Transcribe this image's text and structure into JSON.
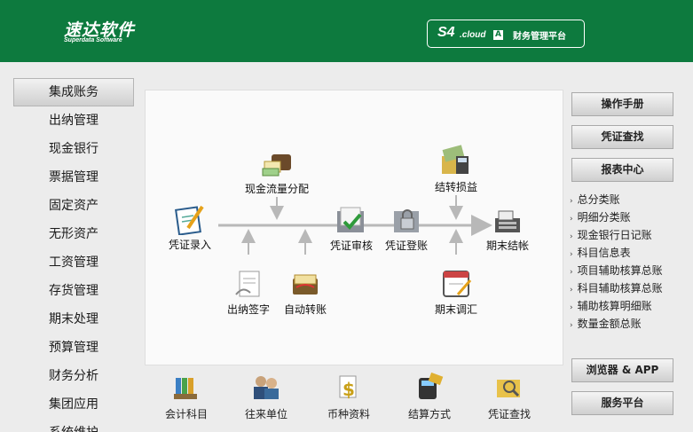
{
  "header": {
    "logo_main": "速达软件",
    "logo_sub": "Superdata Software",
    "product": "S4",
    "cloud": ".cloud",
    "cloud_badge": "A",
    "platform": "财务管理平台"
  },
  "sidebar": {
    "items": [
      {
        "label": "集成账务"
      },
      {
        "label": "出纳管理"
      },
      {
        "label": "现金银行"
      },
      {
        "label": "票据管理"
      },
      {
        "label": "固定资产"
      },
      {
        "label": "无形资产"
      },
      {
        "label": "工资管理"
      },
      {
        "label": "存货管理"
      },
      {
        "label": "期末处理"
      },
      {
        "label": "预算管理"
      },
      {
        "label": "财务分析"
      },
      {
        "label": "集团应用"
      },
      {
        "label": "系统维护"
      }
    ]
  },
  "flow": {
    "voucher_entry": "凭证录入",
    "cashflow_alloc": "现金流量分配",
    "cashier_sign": "出纳签字",
    "auto_transfer": "自动转账",
    "voucher_audit": "凭证审核",
    "voucher_post": "凭证登账",
    "carry_pl": "结转损益",
    "period_adjust": "期末调汇",
    "period_close": "期末结帐"
  },
  "right": {
    "manual": "操作手册",
    "voucher_query": "凭证查找",
    "report_center": "报表中心",
    "links": [
      "总分类账",
      "明细分类账",
      "现金银行日记账",
      "科目信息表",
      "项目辅助核算总账",
      "科目辅助核算总账",
      "辅助核算明细账",
      "数量金额总账"
    ],
    "browser_app": "浏览器 & APP",
    "service": "服务平台"
  },
  "bottom": {
    "items": [
      "会计科目",
      "往来单位",
      "币种资料",
      "结算方式",
      "凭证查找"
    ]
  },
  "colors": {
    "header_green": "#0d7a3e",
    "arrow_gray": "#b8b8b8"
  }
}
